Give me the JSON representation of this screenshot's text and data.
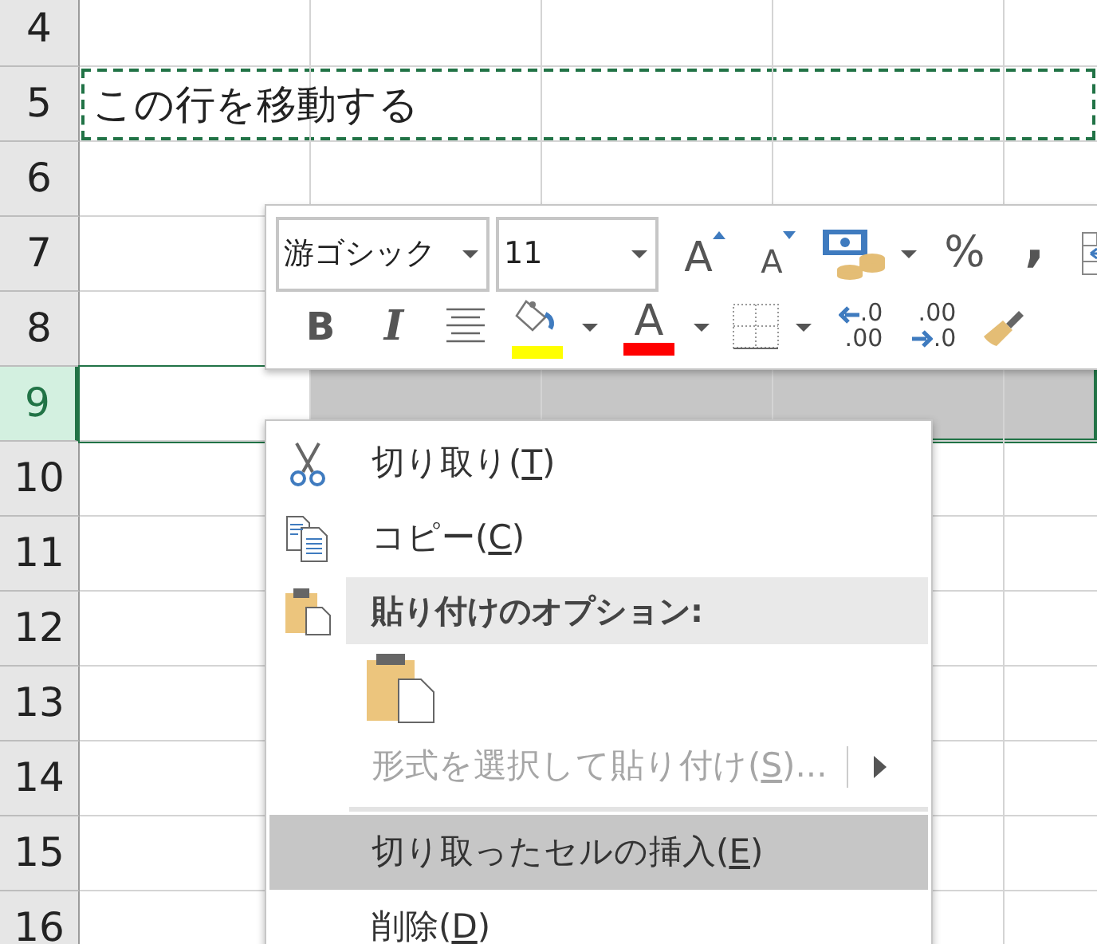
{
  "sheet": {
    "rows": [
      {
        "header": "4",
        "selected": false,
        "cut_marquee": false
      },
      {
        "header": "5",
        "text": "この行を移動する",
        "selected": false,
        "cut_marquee": true
      },
      {
        "header": "6",
        "selected": false,
        "cut_marquee": false
      },
      {
        "header": "7",
        "selected": false,
        "cut_marquee": false
      },
      {
        "header": "8",
        "selected": false,
        "cut_marquee": false
      },
      {
        "header": "9",
        "selected": true,
        "cut_marquee": false
      },
      {
        "header": "10",
        "selected": false,
        "cut_marquee": false
      },
      {
        "header": "11",
        "selected": false,
        "cut_marquee": false
      },
      {
        "header": "12",
        "selected": false,
        "cut_marquee": false
      },
      {
        "header": "13",
        "selected": false,
        "cut_marquee": false
      },
      {
        "header": "14",
        "selected": false,
        "cut_marquee": false
      },
      {
        "header": "15",
        "selected": false,
        "cut_marquee": false
      },
      {
        "header": "16",
        "selected": false,
        "cut_marquee": false
      }
    ]
  },
  "mini_toolbar": {
    "font_name": "游ゴシック",
    "font_size": "11",
    "row_1": [
      {
        "kind": "grow_font",
        "glyph": "A",
        "dropdown": false
      },
      {
        "kind": "shrink_font",
        "glyph": "A",
        "dropdown": false
      },
      {
        "kind": "accounting",
        "dropdown": true
      },
      {
        "kind": "percent",
        "glyph": "%",
        "dropdown": false
      },
      {
        "kind": "comma",
        "glyph": ",",
        "dropdown": false
      },
      {
        "kind": "wrap",
        "dropdown": false
      }
    ],
    "row_2": [
      {
        "kind": "bold",
        "glyph": "B",
        "dropdown": false
      },
      {
        "kind": "italic",
        "glyph": "I",
        "dropdown": false
      },
      {
        "kind": "align",
        "dropdown": false
      },
      {
        "kind": "fill",
        "color": "#ffff00",
        "dropdown": true
      },
      {
        "kind": "font_color",
        "glyph": "A",
        "color": "#ff0000",
        "dropdown": true
      },
      {
        "kind": "borders",
        "dropdown": true
      },
      {
        "kind": "increase_decimal",
        "glyph_top": ".0",
        "glyph_bottom": ".00",
        "dropdown": false
      },
      {
        "kind": "decrease_decimal",
        "glyph_top": ".00",
        "glyph_bottom": ".0",
        "dropdown": false
      },
      {
        "kind": "format_painter",
        "dropdown": false
      }
    ]
  },
  "context_menu": {
    "items": [
      {
        "kind": "command",
        "text_before": "切り取り(",
        "access_key": "T",
        "text_after": ")",
        "disabled": false,
        "selected": false,
        "submenu": false
      },
      {
        "kind": "command",
        "text_before": "コピー(",
        "access_key": "C",
        "text_after": ")",
        "disabled": false,
        "selected": false,
        "submenu": false
      },
      {
        "kind": "header",
        "label": "貼り付けのオプション:"
      },
      {
        "kind": "paste_options"
      },
      {
        "kind": "command",
        "text_before": "形式を選択して貼り付け(",
        "access_key": "S",
        "text_after": ")...",
        "disabled": true,
        "selected": false,
        "submenu": true
      },
      {
        "kind": "separator"
      },
      {
        "kind": "command",
        "text_before": "切り取ったセルの挿入(",
        "access_key": "E",
        "text_after": ")",
        "disabled": false,
        "selected": true,
        "submenu": false
      },
      {
        "kind": "command",
        "text_before": "削除(",
        "access_key": "D",
        "text_after": ")",
        "disabled": false,
        "selected": false,
        "submenu": false
      }
    ]
  }
}
